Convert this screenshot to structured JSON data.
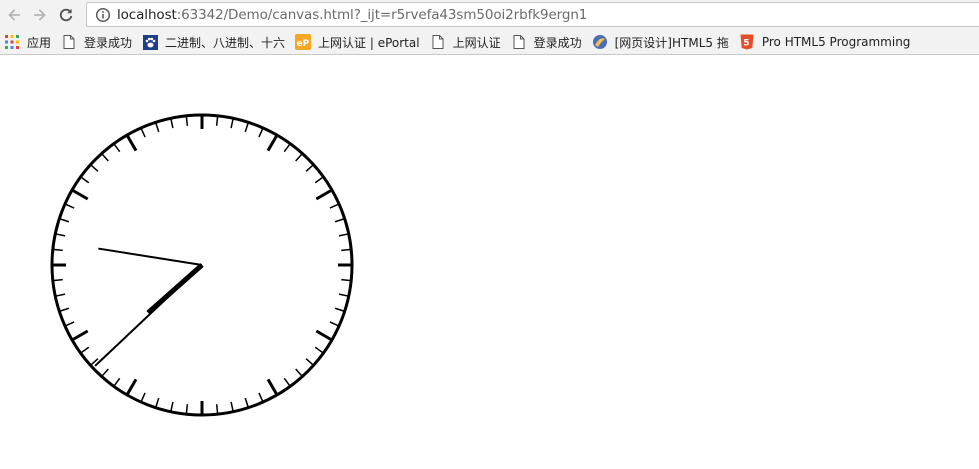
{
  "toolbar": {
    "back_icon": "back-arrow-icon",
    "forward_icon": "forward-arrow-icon",
    "reload_icon": "reload-icon",
    "info_icon": "info-icon",
    "url_host": "localhost",
    "url_path": ":63342/Demo/canvas.html?_ijt=r5rvefa43sm50oi2rbfk9ergn1"
  },
  "bookmarks": [
    {
      "label": "应用",
      "icon": "apps-grid-icon"
    },
    {
      "label": "登录成功",
      "icon": "page-icon"
    },
    {
      "label": "二进制、八进制、十六",
      "icon": "paw-icon"
    },
    {
      "label": "上网认证 | ePortal",
      "icon": "eportal-icon"
    },
    {
      "label": "上网认证",
      "icon": "page-icon"
    },
    {
      "label": "登录成功",
      "icon": "page-icon"
    },
    {
      "label": "[网页设计]HTML5 拖",
      "icon": "site-icon"
    },
    {
      "label": "Pro HTML5 Programming",
      "icon": "html5-icon"
    }
  ],
  "clock": {
    "hour": 7,
    "minute": 37,
    "second": 46.5
  },
  "colors": {
    "chrome_bg": "#f2f2f2",
    "ink": "#000000",
    "apps_icon_colors": [
      "#e94235",
      "#fbbc04",
      "#34a853",
      "#4285f4"
    ],
    "eportal_orange": "#f5a623",
    "html5_orange": "#e44d26"
  }
}
